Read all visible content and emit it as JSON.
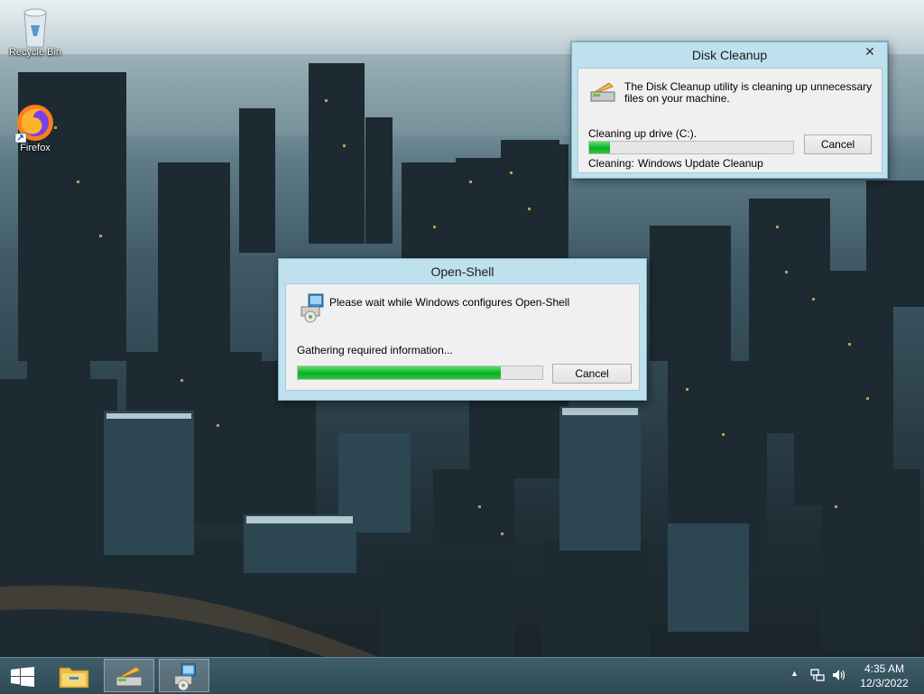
{
  "desktop": {
    "icons": [
      {
        "label": "Recycle Bin",
        "icon": "recycle-bin-icon"
      },
      {
        "label": "Firefox",
        "icon": "firefox-icon"
      }
    ]
  },
  "disk_cleanup": {
    "title": "Disk Cleanup",
    "message": "The Disk Cleanup utility is cleaning up unnecessary files on your machine.",
    "drive_label": "Cleaning up drive  (C:).",
    "cancel_label": "Cancel",
    "progress_percent": 10,
    "cleaning_label": "Cleaning:",
    "cleaning_item": "Windows Update Cleanup",
    "close_glyph": "✕"
  },
  "open_shell": {
    "title": "Open-Shell",
    "message": "Please wait while Windows configures Open-Shell",
    "status": "Gathering required information...",
    "cancel_label": "Cancel",
    "progress_percent": 83
  },
  "taskbar": {
    "items": [
      {
        "name": "start-button",
        "icon": "windows-logo-icon"
      },
      {
        "name": "file-explorer",
        "icon": "folder-icon"
      },
      {
        "name": "disk-cleanup",
        "icon": "disk-cleanup-icon"
      },
      {
        "name": "open-shell-installer",
        "icon": "installer-icon"
      }
    ],
    "tray": {
      "overflow_glyph": "▲",
      "time": "4:35 AM",
      "date": "12/3/2022"
    }
  },
  "colors": {
    "progress_green": "#06b025",
    "dialog_frame": "#bfe1ee",
    "taskbar": "#2f4a56"
  }
}
